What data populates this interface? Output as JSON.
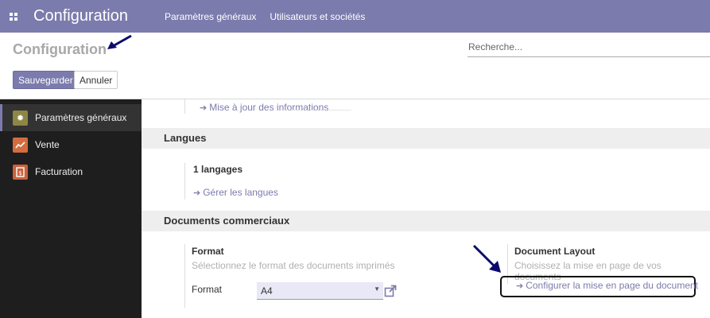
{
  "navbar": {
    "brand": "Configuration",
    "menu": [
      "Paramètres généraux",
      "Utilisateurs et sociétés"
    ]
  },
  "control_panel": {
    "title": "Configuration",
    "search_placeholder": "Recherche...",
    "save_label": "Sauvegarder",
    "cancel_label": "Annuler"
  },
  "sidebar": {
    "items": [
      {
        "label": "Paramètres généraux",
        "icon": "gear-icon",
        "active": true
      },
      {
        "label": "Vente",
        "icon": "chart-line-icon",
        "active": false
      },
      {
        "label": "Facturation",
        "icon": "invoice-icon",
        "active": false
      }
    ]
  },
  "content": {
    "update_link": "Mise à jour des informations",
    "langues": {
      "title": "Langues",
      "count_label": "1 langages",
      "manage_link": "Gérer les langues"
    },
    "documents": {
      "title": "Documents commerciaux",
      "format_title": "Format",
      "format_help": "Sélectionnez le format des documents imprimés",
      "format_field_label": "Format",
      "format_value": "A4",
      "layout_title": "Document Layout",
      "layout_help": "Choisissez la mise en page de vos documents",
      "layout_link": "Configurer la mise en page du document"
    }
  },
  "colors": {
    "accent": "#7c7bad",
    "sidebar_bg": "#1e1e1e",
    "annotation_arrow": "#0a0a6e"
  }
}
